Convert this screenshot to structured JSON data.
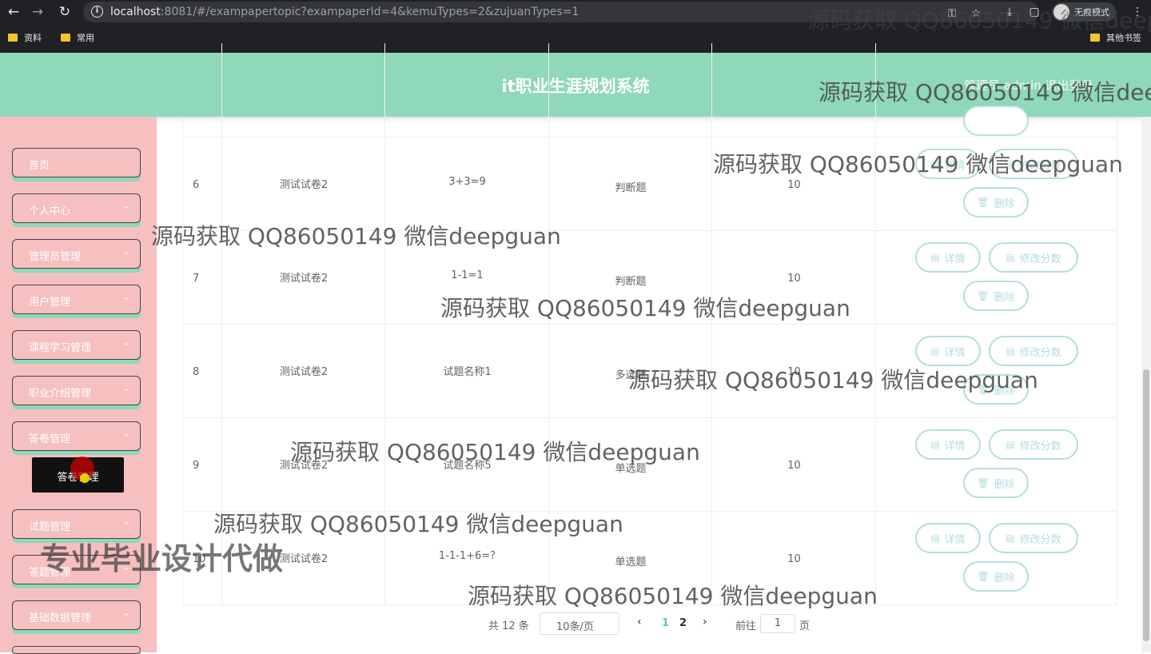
{
  "browser": {
    "url_host": "localhost",
    "url_rest": ":8081/#/exampapertopic?exampaperId=4&kemuTypes=2&zujuanTypes=1",
    "profile_name": "无痕模式",
    "bookmarks": [
      "资料",
      "常用"
    ],
    "other_bookmarks": "其他书签"
  },
  "header": {
    "title": "it职业生涯规划系统",
    "user_text": "管理员 admin   退出登录"
  },
  "sidebar": {
    "items": [
      {
        "label": "首页",
        "has_chevron": false
      },
      {
        "label": "个人中心",
        "has_chevron": true
      },
      {
        "label": "管理员管理",
        "has_chevron": true
      },
      {
        "label": "用户管理",
        "has_chevron": true
      },
      {
        "label": "课程学习管理",
        "has_chevron": true
      },
      {
        "label": "职业介绍管理",
        "has_chevron": true
      },
      {
        "label": "答卷管理",
        "has_chevron": true
      },
      {
        "label": "试题管理",
        "has_chevron": true
      },
      {
        "label": "答题管理",
        "has_chevron": true
      },
      {
        "label": "基础数据管理",
        "has_chevron": true
      }
    ],
    "sub_item": "答卷管理"
  },
  "table": {
    "rows": [
      {
        "index": "6",
        "paper": "测试试卷2",
        "question": "3+3=9",
        "type": "判断题",
        "score": "10"
      },
      {
        "index": "7",
        "paper": "测试试卷2",
        "question": "1-1=1",
        "type": "判断题",
        "score": "10"
      },
      {
        "index": "8",
        "paper": "测试试卷2",
        "question": "试题名称1",
        "type": "多选题",
        "score": "10"
      },
      {
        "index": "9",
        "paper": "测试试卷2",
        "question": "试题名称5",
        "type": "单选题",
        "score": "10"
      },
      {
        "index": "10",
        "paper": "测试试卷2",
        "question": "1-1-1+6=?",
        "type": "单选题",
        "score": "10"
      }
    ],
    "actions": {
      "detail": "详情",
      "edit_score": "修改分数",
      "delete": "删除"
    }
  },
  "pagination": {
    "total": "共 12 条",
    "page_size": "10条/页",
    "pages": [
      "1",
      "2"
    ],
    "current": "1",
    "goto_label": "前往",
    "goto_value": "1",
    "goto_unit": "页"
  },
  "watermark": {
    "text": "源码获取 QQ86050149 微信deepguan",
    "big_text": "专业毕业设计代做"
  }
}
